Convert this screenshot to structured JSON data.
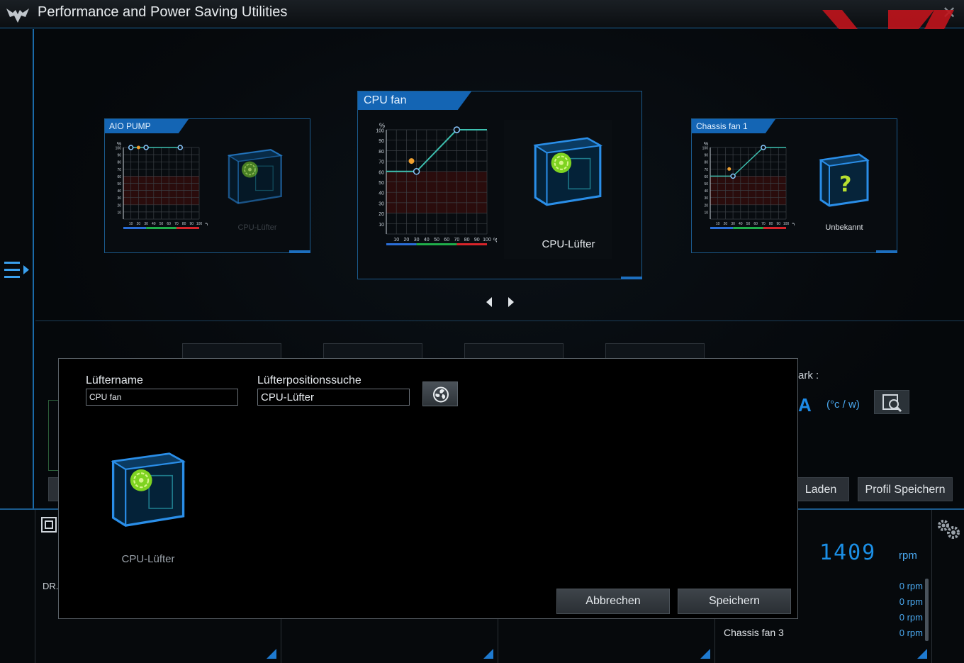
{
  "window": {
    "title": "Performance and Power Saving Utilities",
    "close_glyph": "✕"
  },
  "fan_cards": [
    {
      "name": "AIO PUMP",
      "location": "CPU-Lüfter",
      "y_unit": "%",
      "x_unit": "℃",
      "y_ticks": [
        "100",
        "90",
        "80",
        "70",
        "60",
        "50",
        "40",
        "30",
        "20",
        "10"
      ],
      "x_ticks": [
        "10",
        "20",
        "30",
        "40",
        "50",
        "60",
        "70",
        "80",
        "90",
        "100"
      ],
      "curve": [
        [
          10,
          100
        ],
        [
          30,
          100
        ],
        [
          75,
          100
        ]
      ],
      "location_dim": true
    },
    {
      "name": "CPU fan",
      "location": "CPU-Lüfter",
      "y_unit": "%",
      "x_unit": "℃",
      "y_ticks": [
        "100",
        "90",
        "80",
        "70",
        "60",
        "50",
        "40",
        "30",
        "20",
        "10"
      ],
      "x_ticks": [
        "10",
        "20",
        "30",
        "40",
        "50",
        "60",
        "70",
        "80",
        "90",
        "100"
      ],
      "curve": [
        [
          0,
          60
        ],
        [
          30,
          60
        ],
        [
          70,
          100
        ],
        [
          100,
          100
        ]
      ],
      "location_dim": false
    },
    {
      "name": "Chassis fan 1",
      "location": "Unbekannt",
      "y_unit": "%",
      "x_unit": "℃",
      "y_ticks": [
        "100",
        "90",
        "80",
        "70",
        "60",
        "50",
        "40",
        "30",
        "20",
        "10"
      ],
      "x_ticks": [
        "10",
        "20",
        "30",
        "40",
        "50",
        "60",
        "70",
        "80",
        "90",
        "100"
      ],
      "curve": [
        [
          0,
          60
        ],
        [
          30,
          60
        ],
        [
          70,
          100
        ],
        [
          100,
          100
        ]
      ],
      "location_dim": false
    }
  ],
  "behind": {
    "mark_label": "ark :",
    "unit_a": "A",
    "unit_cw": "(°c / w)",
    "load_label": "Laden",
    "save_profile_label": "Profil Speichern",
    "dr_label": "DR.",
    "rpm_big": "1409",
    "rpm_unit": "rpm",
    "rpm_rows": [
      "0   rpm",
      "0   rpm",
      "0   rpm",
      "0   rpm"
    ],
    "chassis3_label": "Chassis fan 3"
  },
  "dialog": {
    "fan_name_label": "Lüftername",
    "fan_name_value": "CPU fan",
    "position_label": "Lüfterpositionssuche",
    "position_value": "CPU-Lüfter",
    "pc_caption": "CPU-Lüfter",
    "cancel_label": "Abbrechen",
    "save_label": "Speichern"
  },
  "colors": {
    "accent_blue": "#1465b4",
    "curve": "#3ec0b0",
    "xx_logo_red": "#c0141c"
  }
}
